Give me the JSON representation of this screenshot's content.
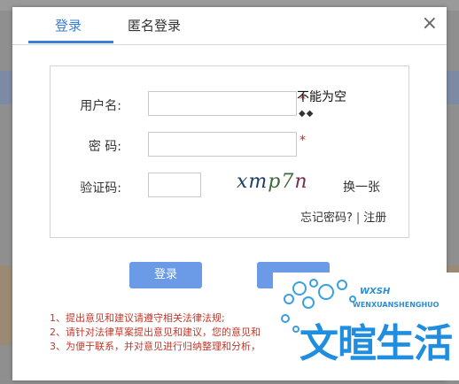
{
  "tabs": {
    "login": "登录",
    "anonymous": "匿名登录"
  },
  "close": "×",
  "form": {
    "username_label": "用户名:",
    "password_label": "密  码:",
    "captcha_label": "验证码:",
    "required_mark": "*",
    "username_error": "不能为空",
    "error_diamonds": "◆◆",
    "captcha_text_1": "xm",
    "captcha_text_2": "p7",
    "captcha_text_3": "n",
    "swap_captcha": "换一张",
    "forgot_password": "忘记密码?",
    "register": "注册",
    "link_separator": "|"
  },
  "buttons": {
    "login": "登录",
    "second": ""
  },
  "notes": [
    "1、提出意见和建议请遵守相关法律法规;",
    "2、请针对法律草案提出意见和建议，您的意见和",
    "3、为便于联系，并对意见进行归纳整理和分析，"
  ],
  "watermark": {
    "latin": "WENXUANSHENGHUO",
    "initials": "WXSH",
    "chinese": "文暄生活"
  },
  "colors": {
    "accent": "#3b7fd4",
    "button": "#6b9be6",
    "required": "#d32020",
    "note": "#c0392b"
  }
}
